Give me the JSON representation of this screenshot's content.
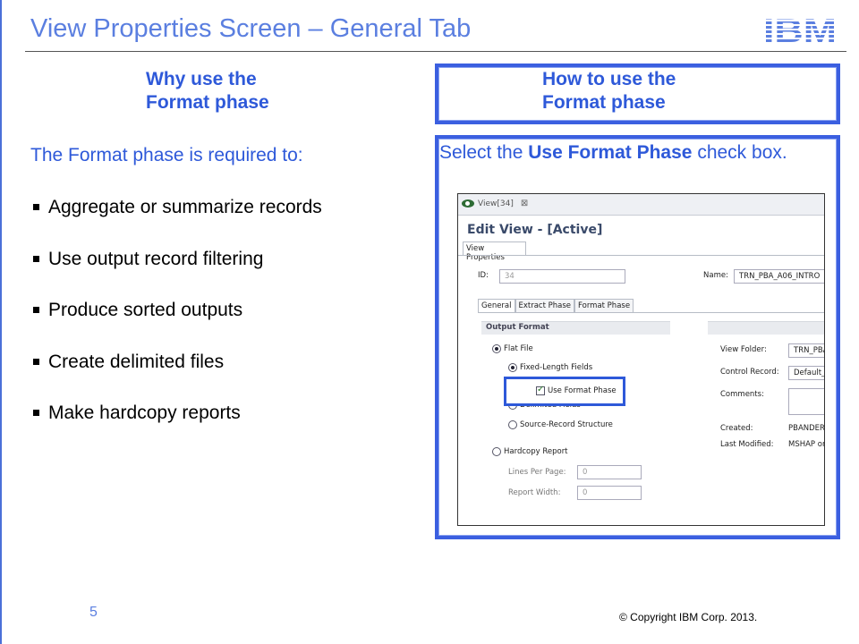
{
  "slide": {
    "title": "View Properties Screen – General Tab",
    "logo": "IBM",
    "page_number": "5",
    "copyright": "© Copyright  IBM Corp. 2013."
  },
  "left": {
    "heading_line1": "Why use the",
    "heading_line2": "Format phase",
    "intro": "The Format phase is required to:",
    "bullets": [
      "Aggregate or summarize records",
      "Use output record filtering",
      "Produce sorted outputs",
      "Create delimited files",
      "Make hardcopy reports"
    ]
  },
  "right": {
    "heading_line1": "How to use the",
    "heading_line2": "Format phase",
    "instruction_pre": "Select the ",
    "instruction_bold": "Use Format Phase",
    "instruction_post": " check box."
  },
  "screenshot": {
    "editor_tab": "View[34]",
    "editor_title": "Edit View - [Active]",
    "properties_tab": "View Properties",
    "id_label": "ID:",
    "id_value": "34",
    "name_label": "Name:",
    "name_value": "TRN_PBA_A06_INTRO",
    "subtabs": [
      "General",
      "Extract Phase",
      "Format Phase"
    ],
    "active_subtab": "General",
    "section_title": "Output Format",
    "flat_file": "Flat File",
    "fixed_length": "Fixed-Length Fields",
    "use_format_phase": "Use Format Phase",
    "use_format_phase_checked": true,
    "delimited": "Delimited Fields",
    "source_record": "Source-Record Structure",
    "hardcopy": "Hardcopy Report",
    "lines_per_page_label": "Lines Per Page:",
    "lines_per_page_value": "0",
    "report_width_label": "Report Width:",
    "report_width_value": "0",
    "view_folder_label": "View Folder:",
    "view_folder_value": "TRN_PBA",
    "control_record_label": "Control Record:",
    "control_record_value": "Default_",
    "comments_label": "Comments:",
    "created_label": "Created:",
    "created_value": "PBANDER",
    "last_modified_label": "Last Modified:",
    "last_modified_value": "MSHAP on"
  },
  "colors": {
    "accent": "#2e59d9",
    "title": "#5b7fe0",
    "box_border": "#3b5fe0"
  }
}
